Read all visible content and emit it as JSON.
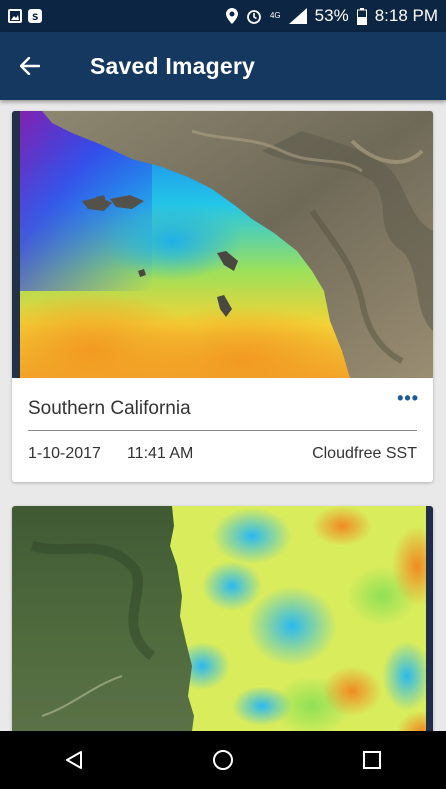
{
  "status_bar": {
    "battery": "53%",
    "time": "8:18 PM",
    "network": "4G"
  },
  "app_bar": {
    "title": "Saved Imagery",
    "back_icon": "arrow-left-icon"
  },
  "saved_items": [
    {
      "name": "Southern California",
      "date": "1-10-2017",
      "time": "11:41 AM",
      "product": "Cloudfree SST"
    }
  ],
  "colors": {
    "status_bar": "#0c2543",
    "app_bar": "#143860",
    "accent": "#1a5b9a",
    "background": "#e9e9ea"
  },
  "nav_bar": {
    "icons": [
      "back-triangle-icon",
      "home-circle-icon",
      "recents-square-icon"
    ]
  }
}
